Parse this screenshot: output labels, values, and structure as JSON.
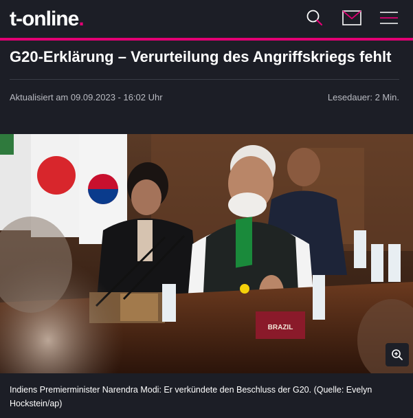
{
  "header": {
    "logo_main": "t-online",
    "logo_dot": ".",
    "icons": [
      "search-icon",
      "mail-icon",
      "menu-icon"
    ],
    "accent_color": "#e20074"
  },
  "article": {
    "title": "G20-Erklärung – Verurteilung des Angriffskriegs fehlt",
    "updated": "Aktualisiert am 09.09.2023 - 16:02 Uhr",
    "reading_time": "Lesedauer: 2 Min."
  },
  "image": {
    "caption": "Indiens Premierminister Narendra Modi: Er verkündete den Beschluss der G20. (Quelle: Evelyn Hockstein/ap)",
    "placard_text": "BRAZIL"
  }
}
